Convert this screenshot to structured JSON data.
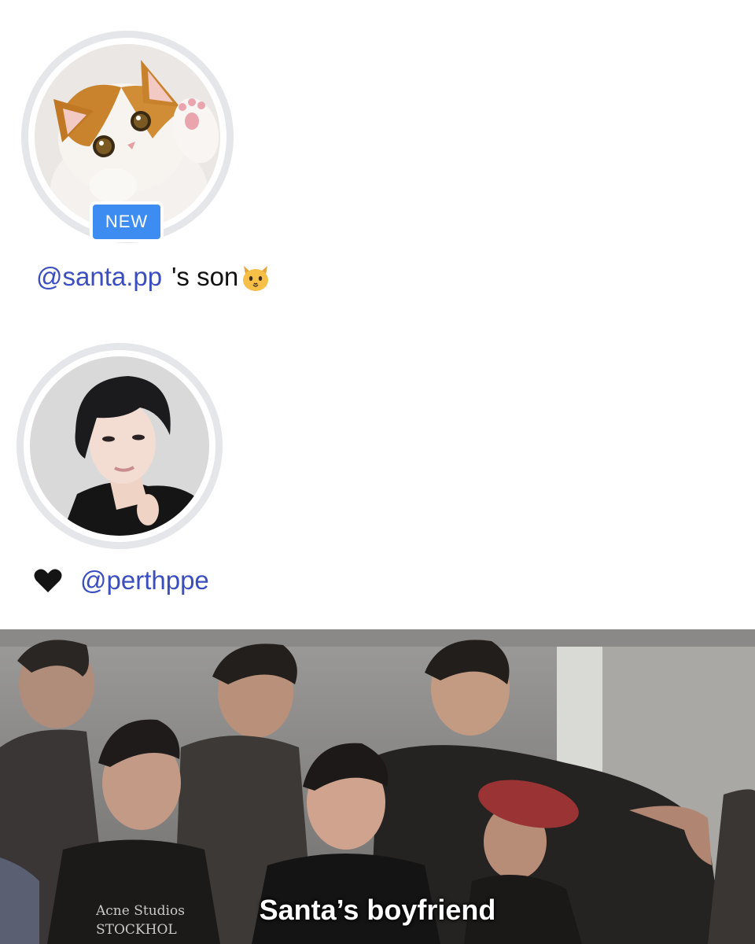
{
  "profile_cat": {
    "badge": "NEW",
    "bio_mention": "@santa.pp",
    "bio_text": "'s son",
    "bio_emoji": "🐱"
  },
  "profile_person": {
    "bio_emoji": "🖤",
    "bio_mention": "@perthppe"
  },
  "photo": {
    "caption": "Santa’s boyfriend",
    "shirt_text_line1": "Acne Studios",
    "shirt_text_line2": "STOCKHOL"
  },
  "colors": {
    "mention": "#3b4ec0",
    "badge": "#3d8cf1",
    "ring": "#e4e6ea"
  }
}
